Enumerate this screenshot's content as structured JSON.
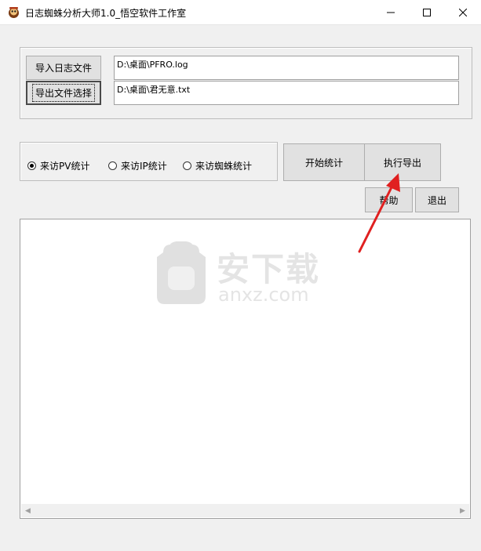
{
  "window": {
    "title": "日志蜘蛛分析大师1.0_悟空软件工作室",
    "controls": {
      "minimize": "minimize-icon",
      "maximize": "maximize-icon",
      "close": "close-icon"
    }
  },
  "files": {
    "import_button": "导入日志文件",
    "export_select_button": "导出文件选择",
    "log_path": "D:\\桌面\\PFRO.log",
    "output_path": "D:\\桌面\\君无意.txt"
  },
  "mode": {
    "options": [
      {
        "label": "来访PV统计",
        "checked": true
      },
      {
        "label": "来访IP统计",
        "checked": false
      },
      {
        "label": "来访蜘蛛统计",
        "checked": false
      }
    ]
  },
  "actions": {
    "start": "开始统计",
    "execute_export": "执行导出",
    "help": "帮助",
    "quit": "退出"
  },
  "watermark": {
    "cn": "安下载",
    "en": "anxz.com"
  },
  "colors": {
    "arrow": "#e02020",
    "background": "#f0f0f0",
    "field": "#ffffff"
  }
}
